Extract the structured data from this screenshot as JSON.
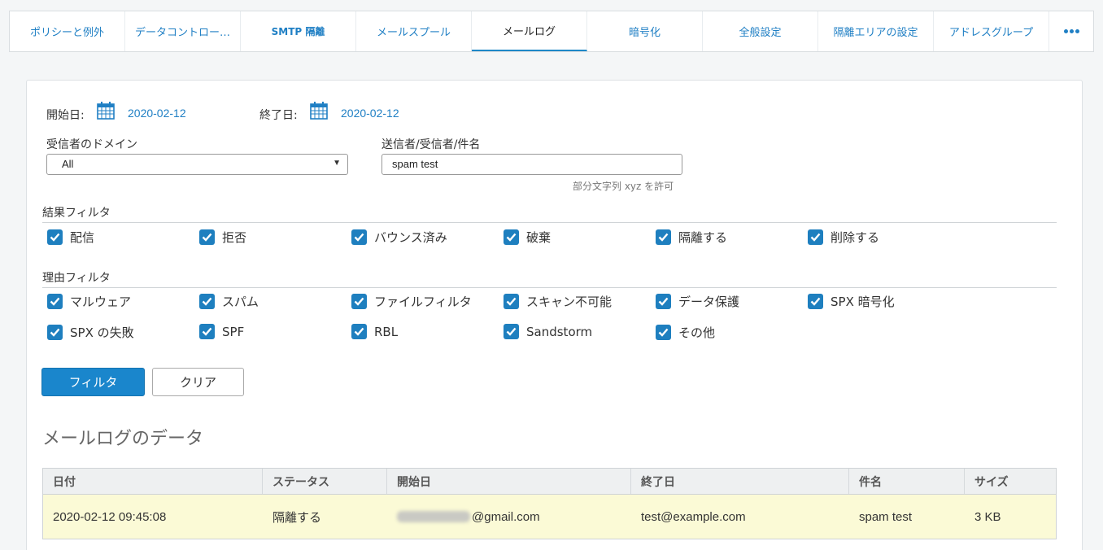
{
  "tabs": [
    {
      "label": "ポリシーと例外",
      "active": false
    },
    {
      "label": "データコントロー…",
      "active": false
    },
    {
      "label": "SMTP 隔離",
      "active": false
    },
    {
      "label": "メールスプール",
      "active": false
    },
    {
      "label": "メールログ",
      "active": true
    },
    {
      "label": "暗号化",
      "active": false
    },
    {
      "label": "全般設定",
      "active": false
    },
    {
      "label": "隔離エリアの設定",
      "active": false
    },
    {
      "label": "アドレスグループ",
      "active": false
    }
  ],
  "filters": {
    "start_label": "開始日:",
    "start_date": "2020-02-12",
    "end_label": "終了日:",
    "end_date": "2020-02-12",
    "domain_label": "受信者のドメイン",
    "domain_value": "All",
    "search_label": "送信者/受信者/件名",
    "search_value": "spam test",
    "search_hint": "部分文字列 xyz を許可"
  },
  "result_filter": {
    "title": "結果フィルタ",
    "items": [
      "配信",
      "拒否",
      "バウンス済み",
      "破棄",
      "隔離する",
      "削除する"
    ]
  },
  "reason_filter": {
    "title": "理由フィルタ",
    "items": [
      "マルウェア",
      "スパム",
      "ファイルフィルタ",
      "スキャン不可能",
      "データ保護",
      "SPX 暗号化",
      "SPX の失敗",
      "SPF",
      "RBL",
      "Sandstorm",
      "その他"
    ]
  },
  "buttons": {
    "filter": "フィルタ",
    "clear": "クリア"
  },
  "data_section": {
    "heading": "メールログのデータ",
    "columns": [
      "日付",
      "ステータス",
      "開始日",
      "終了日",
      "件名",
      "サイズ"
    ],
    "rows": [
      {
        "date": "2020-02-12 09:45:08",
        "status": "隔離する",
        "from": "@gmail.com",
        "to": "test@example.com",
        "subject": "spam test",
        "size": "3 KB"
      }
    ]
  },
  "colors": {
    "accent": "#1a86cc",
    "checkbox": "#1e7fbf",
    "row_highlight": "#fbfad6"
  }
}
